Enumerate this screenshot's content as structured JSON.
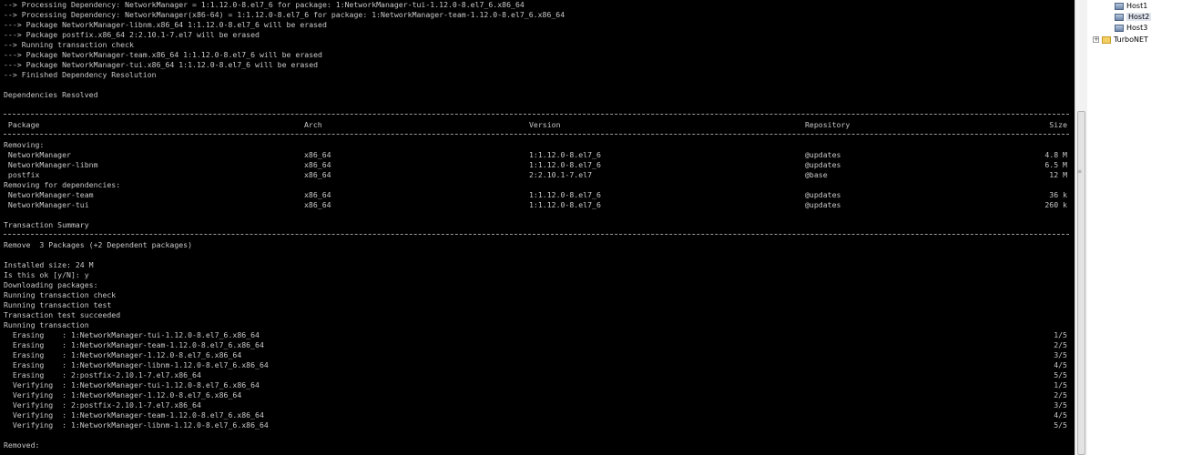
{
  "terminal": {
    "header_lines": [
      "--> Processing Dependency: NetworkManager = 1:1.12.0-8.el7_6 for package: 1:NetworkManager-tui-1.12.0-8.el7_6.x86_64",
      "--> Processing Dependency: NetworkManager(x86-64) = 1:1.12.0-8.el7_6 for package: 1:NetworkManager-team-1.12.0-8.el7_6.x86_64",
      "---> Package NetworkManager-libnm.x86_64 1:1.12.0-8.el7_6 will be erased",
      "---> Package postfix.x86_64 2:2.10.1-7.el7 will be erased",
      "--> Running transaction check",
      "---> Package NetworkManager-team.x86_64 1:1.12.0-8.el7_6 will be erased",
      "---> Package NetworkManager-tui.x86_64 1:1.12.0-8.el7_6 will be erased",
      "--> Finished Dependency Resolution",
      "",
      "Dependencies Resolved"
    ],
    "table_headers": {
      "package": " Package",
      "arch": "Arch",
      "version": "Version",
      "repository": "Repository",
      "size": "Size"
    },
    "removing_label": "Removing:",
    "removing": [
      {
        "package": " NetworkManager",
        "arch": "x86_64",
        "version": "1:1.12.0-8.el7_6",
        "repo": "@updates",
        "size": "4.8 M"
      },
      {
        "package": " NetworkManager-libnm",
        "arch": "x86_64",
        "version": "1:1.12.0-8.el7_6",
        "repo": "@updates",
        "size": "6.5 M"
      },
      {
        "package": " postfix",
        "arch": "x86_64",
        "version": "2:2.10.1-7.el7",
        "repo": "@base",
        "size": "12 M"
      }
    ],
    "deps_label": "Removing for dependencies:",
    "deps": [
      {
        "package": " NetworkManager-team",
        "arch": "x86_64",
        "version": "1:1.12.0-8.el7_6",
        "repo": "@updates",
        "size": "36 k"
      },
      {
        "package": " NetworkManager-tui",
        "arch": "x86_64",
        "version": "1:1.12.0-8.el7_6",
        "repo": "@updates",
        "size": "260 k"
      }
    ],
    "summary_title": "Transaction Summary",
    "summary_line": "Remove  3 Packages (+2 Dependent packages)",
    "post_lines": [
      "",
      "Installed size: 24 M",
      "Is this ok [y/N]: y",
      "Downloading packages:",
      "Running transaction check",
      "Running transaction test",
      "Transaction test succeeded",
      "Running transaction"
    ],
    "steps": [
      {
        "text": "  Erasing    : 1:NetworkManager-tui-1.12.0-8.el7_6.x86_64",
        "count": "1/5"
      },
      {
        "text": "  Erasing    : 1:NetworkManager-team-1.12.0-8.el7_6.x86_64",
        "count": "2/5"
      },
      {
        "text": "  Erasing    : 1:NetworkManager-1.12.0-8.el7_6.x86_64",
        "count": "3/5"
      },
      {
        "text": "  Erasing    : 1:NetworkManager-libnm-1.12.0-8.el7_6.x86_64",
        "count": "4/5"
      },
      {
        "text": "  Erasing    : 2:postfix-2.10.1-7.el7.x86_64",
        "count": "5/5"
      },
      {
        "text": "  Verifying  : 1:NetworkManager-tui-1.12.0-8.el7_6.x86_64",
        "count": "1/5"
      },
      {
        "text": "  Verifying  : 1:NetworkManager-1.12.0-8.el7_6.x86_64",
        "count": "2/5"
      },
      {
        "text": "  Verifying  : 2:postfix-2.10.1-7.el7.x86_64",
        "count": "3/5"
      },
      {
        "text": "  Verifying  : 1:NetworkManager-team-1.12.0-8.el7_6.x86_64",
        "count": "4/5"
      },
      {
        "text": "  Verifying  : 1:NetworkManager-libnm-1.12.0-8.el7_6.x86_64",
        "count": "5/5"
      }
    ],
    "removed_label": "Removed:"
  },
  "tree": {
    "hosts": [
      "Host1",
      "Host2",
      "Host3"
    ],
    "selected": "Host2",
    "folder": "TurboNET",
    "expander": "+"
  },
  "icons": {
    "host": "computer-icon",
    "folder": "folder-icon",
    "expander": "plus-box-icon",
    "grip": "scroll-grip-icon"
  },
  "scroll_grip": "≡"
}
